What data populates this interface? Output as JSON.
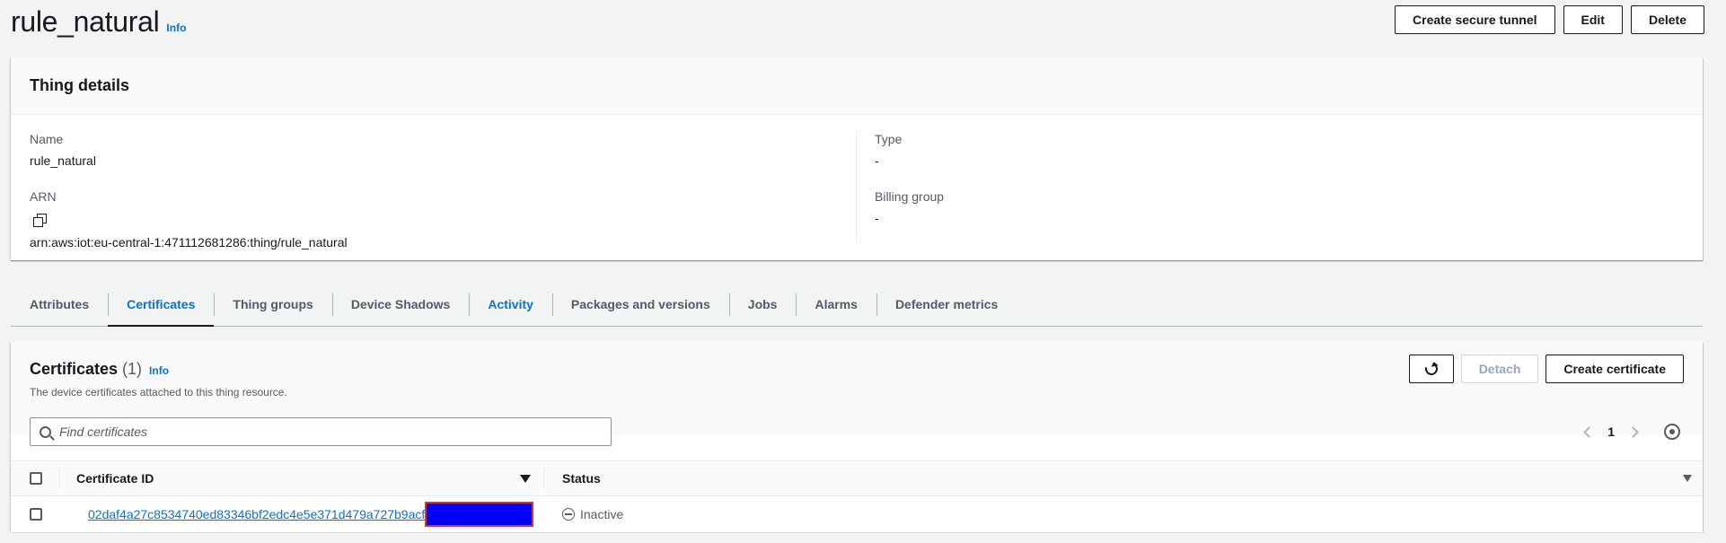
{
  "header": {
    "title": "rule_natural",
    "info": "Info",
    "buttons": {
      "tunnel": "Create secure tunnel",
      "edit": "Edit",
      "delete": "Delete"
    }
  },
  "details": {
    "title": "Thing details",
    "name_label": "Name",
    "name_value": "rule_natural",
    "arn_label": "ARN",
    "arn_value": "arn:aws:iot:eu-central-1:471112681286:thing/rule_natural",
    "type_label": "Type",
    "type_value": "-",
    "billing_label": "Billing group",
    "billing_value": "-"
  },
  "tabs": [
    {
      "label": "Attributes"
    },
    {
      "label": "Certificates"
    },
    {
      "label": "Thing groups"
    },
    {
      "label": "Device Shadows"
    },
    {
      "label": "Activity"
    },
    {
      "label": "Packages and versions"
    },
    {
      "label": "Jobs"
    },
    {
      "label": "Alarms"
    },
    {
      "label": "Defender metrics"
    }
  ],
  "certificates": {
    "title": "Certificates",
    "count": "(1)",
    "info": "Info",
    "description": "The device certificates attached to this thing resource.",
    "detach": "Detach",
    "create": "Create certificate",
    "search_placeholder": "Find certificates",
    "page": "1",
    "col_id": "Certificate ID",
    "col_status": "Status",
    "rows": [
      {
        "id": "02daf4a27c8534740ed83346bf2edc4e5e371d479a727b9acf",
        "status": "Inactive"
      }
    ]
  },
  "icons": {
    "copy": "copy-icon",
    "refresh": "refresh-icon",
    "search": "search-icon",
    "settings": "gear-icon",
    "inactive": "inactive-status-icon"
  },
  "colors": {
    "link": "#0972d3",
    "redaction": "#0000ff",
    "redaction_border": "#e03030"
  }
}
